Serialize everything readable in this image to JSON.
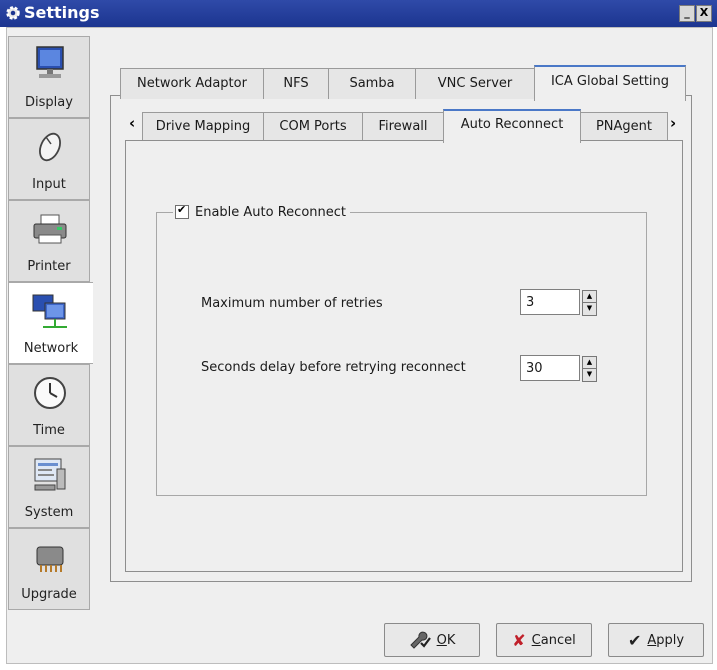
{
  "window": {
    "title": "Settings",
    "minimize": "_",
    "close": "X"
  },
  "sidebar": {
    "items": [
      {
        "label": "Display",
        "icon": "monitor-icon"
      },
      {
        "label": "Input",
        "icon": "mouse-icon"
      },
      {
        "label": "Printer",
        "icon": "printer-icon"
      },
      {
        "label": "Network",
        "icon": "network-icon"
      },
      {
        "label": "Time",
        "icon": "clock-icon"
      },
      {
        "label": "System",
        "icon": "system-icon"
      },
      {
        "label": "Upgrade",
        "icon": "chip-icon"
      }
    ],
    "active": "Network"
  },
  "outer_tabs": {
    "items": [
      "Network Adaptor",
      "NFS",
      "Samba",
      "VNC Server",
      "ICA Global Setting"
    ],
    "active": "ICA Global Setting"
  },
  "inner_tabs": {
    "prev": "‹",
    "next": "›",
    "items": [
      "Drive Mapping",
      "COM Ports",
      "Firewall",
      "Auto Reconnect",
      "PNAgent"
    ],
    "active": "Auto Reconnect"
  },
  "auto_reconnect": {
    "enable_label": "Enable Auto Reconnect",
    "enabled": true,
    "max_retries_label": "Maximum number of retries",
    "max_retries_value": "3",
    "delay_label": "Seconds delay before retrying reconnect",
    "delay_value": "30"
  },
  "buttons": {
    "ok": {
      "icon": "wrench-check-icon",
      "mnemonic": "O",
      "rest": "K"
    },
    "cancel": {
      "icon": "x-icon",
      "mnemonic": "C",
      "rest": "ancel"
    },
    "apply": {
      "icon": "check-icon",
      "mnemonic": "A",
      "rest": "pply"
    }
  },
  "colors": {
    "titlebar": "#1c3590",
    "tab_accent": "#4a78c7",
    "cancel_x": "#c0202a"
  }
}
